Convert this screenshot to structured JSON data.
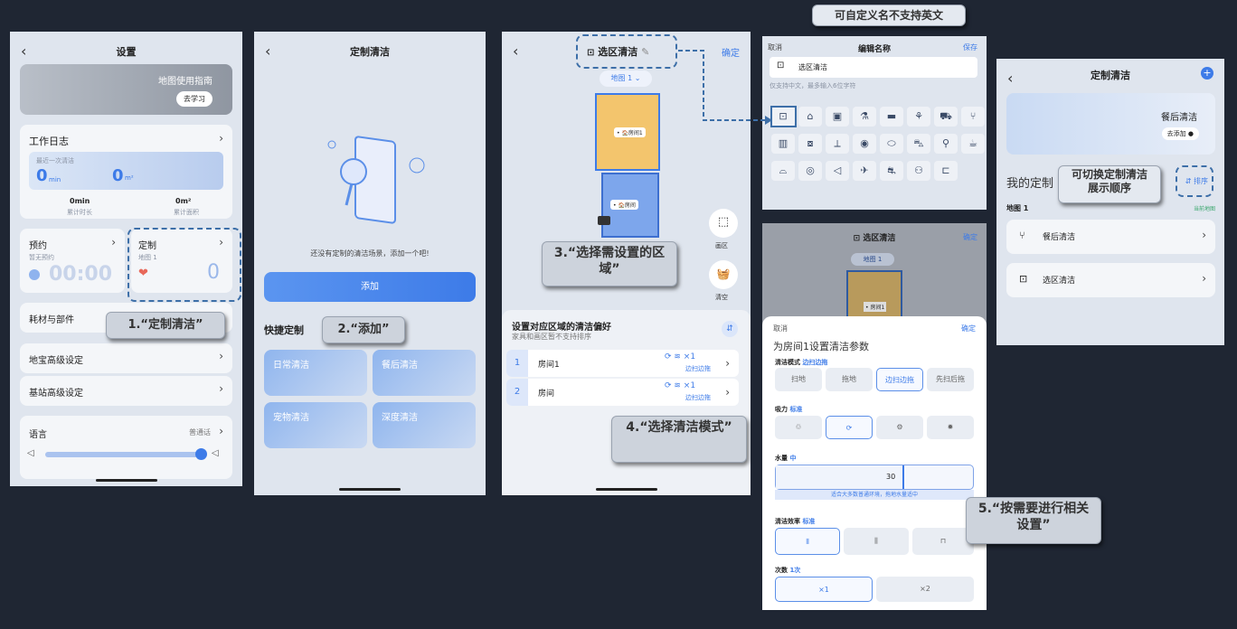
{
  "p1": {
    "title": "设置",
    "guide": "地图使用指南",
    "guide_btn": "去学习",
    "log_title": "工作日志",
    "last_clean": "最近一次清洁",
    "min_val": "0",
    "min_unit": "min",
    "area_val": "0",
    "area_unit": "m²",
    "total_min": "0min",
    "total_min_lbl": "累计时长",
    "total_area": "0m²",
    "total_area_lbl": "累计面积",
    "schedule": "预约",
    "schedule_sub": "暂无预约",
    "schedule_time": "00:00",
    "custom": "定制",
    "custom_sub": "地图 1",
    "custom_val": "0",
    "consumables": "耗材与部件",
    "mop_adv": "地宝高级设定",
    "base_adv": "基站高级设定",
    "language": "语言",
    "language_val": "普通话"
  },
  "p2": {
    "title": "定制清洁",
    "empty": "还没有定制的清洁场景，添加一个吧!",
    "add": "添加",
    "quick": "快捷定制",
    "tiles": [
      "日常清洁",
      "餐后清洁",
      "宠物清洁",
      "深度清洁"
    ]
  },
  "p3": {
    "title": "选区清洁",
    "confirm": "确定",
    "map": "地图 1",
    "room1_tag": "• 🏠房间1",
    "room2_tag": "• 🏠房间",
    "draw": "画区",
    "clear": "清空",
    "pref_title": "设置对应区域的清洁偏好",
    "pref_sub": "家具和画区暂不支持排序",
    "rows": [
      {
        "n": "1",
        "name": "房间1",
        "meta": "边扫边拖"
      },
      {
        "n": "2",
        "name": "房间",
        "meta": "边扫边拖"
      }
    ]
  },
  "p4": {
    "cancel": "取消",
    "title": "编辑名称",
    "save": "保存",
    "value": "选区清洁",
    "hint": "仅支持中文，最多输入6位字符"
  },
  "p5": {
    "title": "选区清洁",
    "confirm": "确定",
    "map": "地图 1",
    "room_tag": "• 房间1",
    "cancel": "取消",
    "ok": "确定",
    "sheet_title": "为房间1设置清洁参数",
    "mode": "清洁模式",
    "mode_val": "边扫边拖",
    "modes": [
      "扫地",
      "拖地",
      "边扫边拖",
      "先扫后拖"
    ],
    "suction": "吸力",
    "suction_val": "标准",
    "water": "水量",
    "water_val": "中",
    "water_num": "30",
    "water_tip": "适合大多数普通环境，拖地水量适中",
    "eff": "清洁效率",
    "eff_val": "标准",
    "times": "次数",
    "times_val": "1次",
    "times_opts": [
      "×1",
      "×2"
    ]
  },
  "p6": {
    "title": "定制清洁",
    "banner": "餐后清洁",
    "banner_btn": "去添加",
    "mine": "我的定制",
    "sort": "⇵ 排序",
    "map": "地图 1",
    "current": "当前地图",
    "items": [
      "餐后清洁",
      "选区清洁"
    ]
  },
  "callouts": {
    "c1": "1.“定制清洁”",
    "c2": "2.“添加”",
    "c3": "3.“选择需设置的区域”",
    "c4": "4.“选择清洁模式”",
    "c5": "5.“按需要进行相关设置”",
    "c6": "可切换定制清洁展示顺序",
    "c7": "可自定义名不支持英文"
  },
  "accent": "#3d7be8"
}
